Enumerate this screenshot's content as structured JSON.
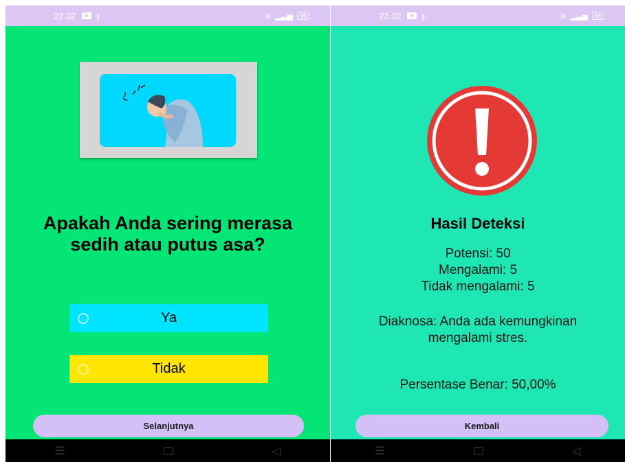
{
  "status_bar": {
    "time": "22.02",
    "battery": "96"
  },
  "question_screen": {
    "question": "Apakah Anda sering merasa sedih atau putus asa?",
    "options": [
      {
        "label": "Ya"
      },
      {
        "label": "Tidak"
      }
    ],
    "next_button": "Selanjutnya"
  },
  "result_screen": {
    "title": "Hasil Deteksi",
    "potensi": "Potensi: 50",
    "mengalami": "Mengalami: 5",
    "tidak_mengalami": "Tidak mengalami: 5",
    "diagnosis": "Diaknosa: Anda ada kemungkinan mengalami stres.",
    "persentase": "Persentase Benar: 50,00%",
    "back_button": "Kembali"
  },
  "colors": {
    "question_bg": "#03e574",
    "result_bg": "#1ee7b3",
    "option_ya": "#00e5ff",
    "option_tidak": "#ffe600",
    "button": "#d2c0f6",
    "status_bar": "#dcc6f3",
    "alert_red": "#e53935"
  },
  "icons": [
    "youtube-icon",
    "flash-icon",
    "wifi-icon",
    "signal-icon",
    "battery-icon",
    "alert-icon",
    "menu-icon",
    "home-icon",
    "back-icon"
  ]
}
